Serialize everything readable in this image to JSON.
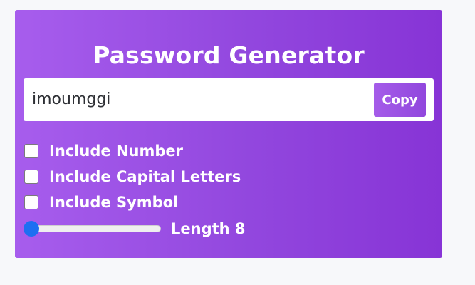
{
  "title": "Password Generator",
  "password": {
    "value": "imoumggi"
  },
  "copy_button": {
    "label": "Copy"
  },
  "options": [
    {
      "label": "Include Number",
      "checked": false
    },
    {
      "label": "Include Capital Letters",
      "checked": false
    },
    {
      "label": "Include Symbol",
      "checked": false
    }
  ],
  "length": {
    "label_prefix": "Length",
    "value": "8",
    "text": "Length 8"
  },
  "colors": {
    "card_gradient_start": "#a75ded",
    "card_gradient_end": "#8734d6",
    "slider_thumb": "#1d6ff2",
    "page_background": "#f7f8fa"
  }
}
